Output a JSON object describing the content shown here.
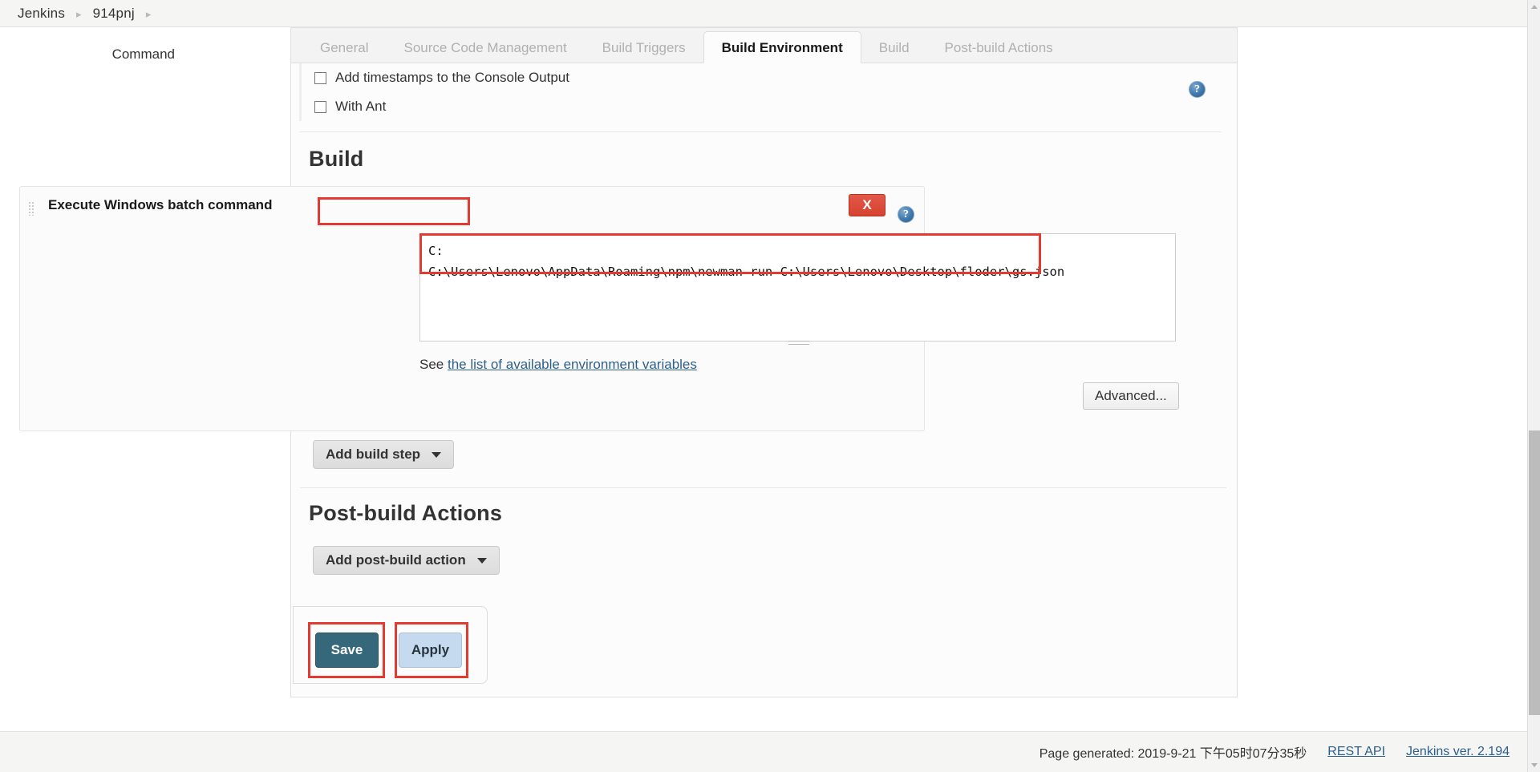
{
  "breadcrumb": {
    "items": [
      {
        "label": "Jenkins"
      },
      {
        "label": "914pnj"
      }
    ],
    "separator": "▸"
  },
  "tabs": [
    {
      "label": "General",
      "active": false
    },
    {
      "label": "Source Code Management",
      "active": false
    },
    {
      "label": "Build Triggers",
      "active": false
    },
    {
      "label": "Build Environment",
      "active": true
    },
    {
      "label": "Build",
      "active": false
    },
    {
      "label": "Post-build Actions",
      "active": false
    }
  ],
  "build_environment": {
    "options": [
      {
        "label": "Add timestamps to the Console Output",
        "checked": false
      },
      {
        "label": "With Ant",
        "checked": false
      }
    ],
    "help_icon": "help-icon",
    "help_glyph": "?"
  },
  "build_section": {
    "heading": "Build",
    "builder": {
      "title": "Execute Windows batch command",
      "delete_label": "X",
      "delete_icon": "close-icon",
      "help_icon": "help-icon",
      "help_glyph": "?",
      "drag_handle_icon": "drag-handle-icon",
      "command_label": "Command",
      "command_value": "C:\nC:\\Users\\Lenovo\\AppData\\Roaming\\npm\\newman run C:\\Users\\Lenovo\\Desktop\\floder\\gs.json",
      "env_hint_prefix": "See ",
      "env_hint_link": "the list of available environment variables",
      "advanced_label": "Advanced..."
    },
    "add_build_step_label": "Add build step",
    "caret_icon": "chevron-down-icon"
  },
  "postbuild_section": {
    "heading": "Post-build Actions",
    "add_postbuild_label": "Add post-build action",
    "caret_icon": "chevron-down-icon"
  },
  "form_actions": {
    "save_label": "Save",
    "apply_label": "Apply"
  },
  "footer": {
    "generated_text": "Page generated: 2019-9-21 下午05时07分35秒",
    "rest_api_label": "REST API",
    "version_label": "Jenkins ver. 2.194"
  },
  "colors": {
    "accent_save": "#35687a",
    "accent_apply": "#c5daee",
    "annotation": "#e23b32",
    "delete_button": "#d6422f",
    "link": "#2d5f8b"
  },
  "scrollbar": {
    "up_icon": "chevron-up-icon",
    "down_icon": "chevron-down-icon",
    "thumb_icon": "scrollbar-thumb"
  }
}
